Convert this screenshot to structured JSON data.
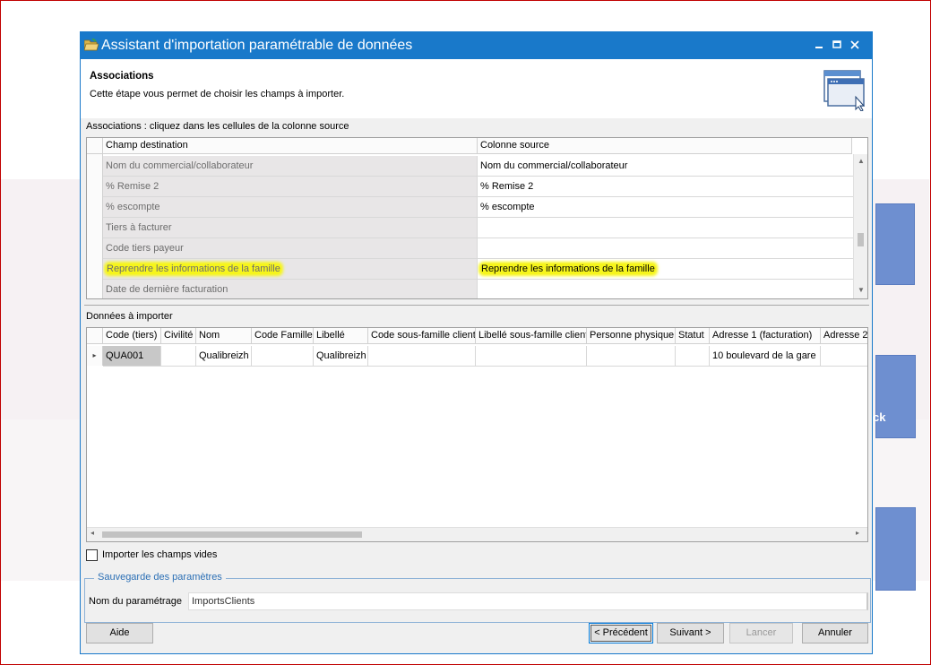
{
  "window": {
    "title": "Assistant d'importation paramétrable de données"
  },
  "header": {
    "title": "Associations",
    "subtitle": "Cette étape vous permet de choisir les champs à importer."
  },
  "associations": {
    "label": "Associations : cliquez dans les cellules de la colonne source",
    "columns": [
      "Champ destination",
      "Colonne source"
    ],
    "rows": [
      {
        "dest": "Nom du commercial/collaborateur",
        "source": "Nom du commercial/collaborateur"
      },
      {
        "dest": "% Remise 2",
        "source": "% Remise 2"
      },
      {
        "dest": "% escompte",
        "source": "% escompte"
      },
      {
        "dest": "Tiers à facturer",
        "source": ""
      },
      {
        "dest": "Code tiers payeur",
        "source": ""
      },
      {
        "dest": "Reprendre les informations de la famille",
        "source": "Reprendre les informations de la famille"
      },
      {
        "dest": "Date de dernière facturation",
        "source": ""
      }
    ]
  },
  "data_import": {
    "label": "Données à importer",
    "columns": [
      "Code (tiers)",
      "Civilité",
      "Nom",
      "Code Famille",
      "Libellé",
      "Code sous-famille client",
      "Libellé sous-famille client",
      "Personne physique",
      "Statut",
      "Adresse 1 (facturation)",
      "Adresse 2"
    ],
    "rows": [
      [
        "QUA001",
        "",
        "Qualibreizh",
        "",
        "Qualibreizh",
        "",
        "",
        "",
        "",
        "10 boulevard de la gare",
        ""
      ]
    ]
  },
  "import_empty": {
    "label": "Importer les champs vides",
    "checked": false
  },
  "save_group": {
    "legend": "Sauvegarde des paramètres",
    "field_label": "Nom du paramétrage",
    "field_value": "ImportsClients"
  },
  "buttons": {
    "help": "Aide",
    "previous": "< Précédent",
    "next": "Suivant >",
    "launch": "Lancer",
    "cancel": "Annuler"
  },
  "background": {
    "fragment": "ck"
  },
  "colors": {
    "titlebar": "#1979ca",
    "highlight": "#f6f51c",
    "group_legend": "#2b6fb5"
  }
}
